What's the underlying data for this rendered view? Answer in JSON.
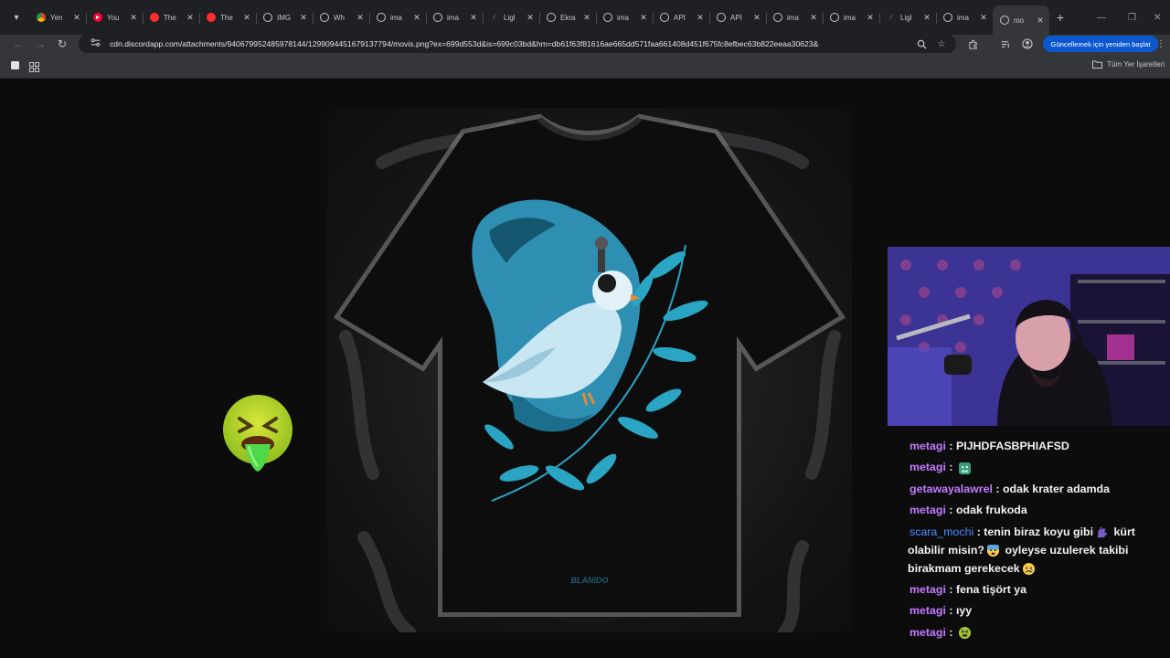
{
  "browser": {
    "tabs": [
      {
        "label": "Yen",
        "icon": "chrome-icon"
      },
      {
        "label": "You",
        "icon": "youtube-icon"
      },
      {
        "label": "The",
        "icon": "red-circle-icon"
      },
      {
        "label": "The",
        "icon": "red-circle-icon"
      },
      {
        "label": "IMG",
        "icon": "globe-icon"
      },
      {
        "label": "Wh",
        "icon": "globe-icon"
      },
      {
        "label": "ima",
        "icon": "globe-icon"
      },
      {
        "label": "ima",
        "icon": "globe-icon"
      },
      {
        "label": "Ligl",
        "icon": "feather-icon"
      },
      {
        "label": "Ekra",
        "icon": "globe-icon"
      },
      {
        "label": "ima",
        "icon": "globe-icon"
      },
      {
        "label": "API",
        "icon": "globe-icon"
      },
      {
        "label": "API",
        "icon": "globe-icon"
      },
      {
        "label": "ima",
        "icon": "globe-icon"
      },
      {
        "label": "ima",
        "icon": "globe-icon"
      },
      {
        "label": "Ligl",
        "icon": "feather-icon"
      },
      {
        "label": "ima",
        "icon": "globe-icon"
      },
      {
        "label": "mo",
        "icon": "globe-icon",
        "active": true
      }
    ],
    "close_glyph": "✕",
    "new_tab_glyph": "+",
    "url": "cdn.discordapp.com/attachments/940679952485978144/1299094451679137794/movis.png?ex=699d553d&is=699c03bd&hm=db61f63f81616ae665dd571faa661408d451f675fc8efbec63b822eeaa30623&",
    "update_button": "Güncellemek için yeniden başlat",
    "all_bookmarks": "Tüm Yer İşaretleri",
    "accent": "#0b57d0"
  },
  "image": {
    "signature": "BLANIDO",
    "alt": "movis.png"
  },
  "chat": {
    "messages": [
      {
        "user": "metagi",
        "color": "#c47bff",
        "text": "PIJHDFASBPHIAFSD"
      },
      {
        "user": "metagi",
        "color": "#c47bff",
        "text": "",
        "emoji": "sick"
      },
      {
        "user": "getawayalawrel",
        "color": "#c47bff",
        "text": "odak krater adamda"
      },
      {
        "user": "metagi",
        "color": "#c47bff",
        "text": "odak frukoda"
      },
      {
        "user": "scara_mochi",
        "color": "#4a8cff",
        "text_parts": [
          "tenin biraz koyu gibi",
          "kürt olabilir misin?",
          "oyleyse uzulerek takibi birakmam gerekecek"
        ]
      },
      {
        "user": "metagi",
        "color": "#c47bff",
        "text": "fena tişört ya"
      },
      {
        "user": "metagi",
        "color": "#c47bff",
        "text": "ıyy"
      },
      {
        "user": "metagi",
        "color": "#c47bff",
        "text": "",
        "emoji": "nauseated"
      }
    ]
  }
}
